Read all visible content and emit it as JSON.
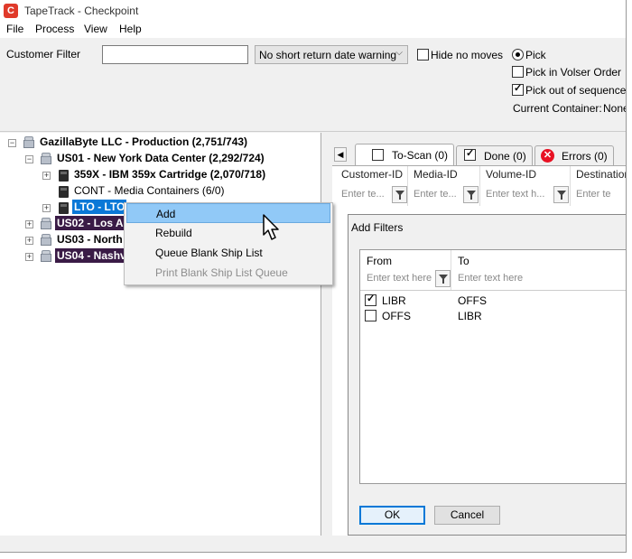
{
  "window": {
    "title": "TapeTrack - Checkpoint",
    "app_icon_letter": "C"
  },
  "menu": [
    "File",
    "Process",
    "View",
    "Help"
  ],
  "toolbar": {
    "customer_filter_label": "Customer Filter",
    "customer_filter_value": "",
    "return_warning_select": "No short return date warning",
    "hide_no_moves_label": "Hide no moves",
    "hide_no_moves_checked": false,
    "pick_label": "Pick",
    "pick_selected": true,
    "pick_volser_label": "Pick in Volser Order",
    "pick_volser_checked": false,
    "pick_out_seq_label": "Pick out of sequence",
    "pick_out_seq_checked": true,
    "current_container_label": "Current Container:",
    "current_container_value": "None"
  },
  "tree": {
    "root": "GazillaByte LLC - Production (2,751/743)",
    "us01": "US01 - New York Data Center (2,292/724)",
    "us01_children": [
      "359X - IBM 359x Cartridge (2,070/718)",
      "CONT - Media Containers (6/0)",
      "LTO - LTO"
    ],
    "us02": "US02 - Los An",
    "us03": "US03 - North",
    "us04": "US04 - Nashv"
  },
  "context_menu": {
    "items": [
      "Add",
      "Rebuild",
      "Queue Blank Ship List",
      "Print Blank Ship List Queue"
    ],
    "hovered": "Add",
    "disabled": [
      "Print Blank Ship List Queue"
    ]
  },
  "tabs": [
    {
      "label": "To-Scan (0)",
      "icon": "unchecked-box-icon"
    },
    {
      "label": "Done (0)",
      "icon": "checked-box-icon"
    },
    {
      "label": "Errors (0)",
      "icon": "error-icon"
    }
  ],
  "grid": {
    "columns": [
      "Customer-ID",
      "Media-ID",
      "Volume-ID",
      "Destination"
    ],
    "filter_placeholders": [
      "Enter te...",
      "Enter te...",
      "Enter text h...",
      "Enter te"
    ]
  },
  "add_filters_dialog": {
    "title": "Add Filters",
    "columns": [
      "From",
      "To"
    ],
    "filter_placeholders": [
      "Enter text here",
      "Enter text here"
    ],
    "rows": [
      {
        "checked": true,
        "from": "LIBR",
        "to": "OFFS"
      },
      {
        "checked": false,
        "from": "OFFS",
        "to": "LIBR"
      }
    ],
    "ok_label": "OK",
    "cancel_label": "Cancel"
  },
  "colors": {
    "selection_blue": "#0a78d7",
    "location_purple": "#3a1b46",
    "menu_hover": "#91c9f7",
    "app_icon": "#e03a2a"
  }
}
